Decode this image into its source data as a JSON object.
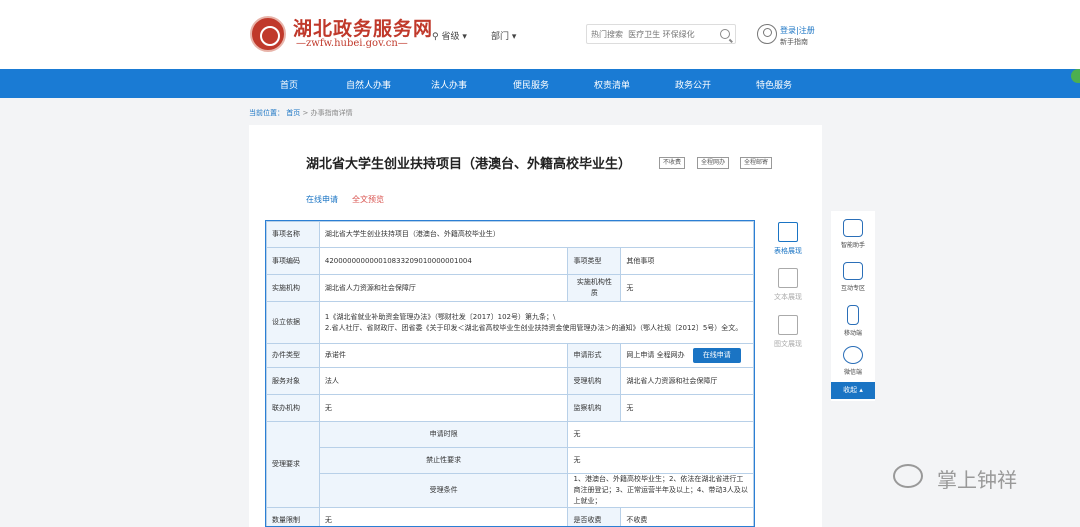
{
  "header": {
    "site_title": "湖北政务服务网",
    "site_url": "—zwfw.hubei.gov.cn—",
    "region_label": "省级",
    "dept_label": "部门",
    "search_placeholder": "热门搜索  医疗卫生 环保绿化",
    "login_label": "登录|注册",
    "guide_label": "新手指南"
  },
  "nav": {
    "items": [
      "首页",
      "自然人办事",
      "法人办事",
      "便民服务",
      "权责清单",
      "政务公开",
      "特色服务"
    ]
  },
  "breadcrumb": {
    "label": "当前位置：",
    "home": "首页",
    "sep": ">",
    "current": "办事指南详情"
  },
  "page": {
    "title": "湖北省大学生创业扶持项目（港澳台、外籍高校毕业生）",
    "tags": [
      "不收费",
      "全程网办",
      "全程邮寄"
    ],
    "link_apply": "在线申请",
    "link_preview": "全文预览"
  },
  "table": {
    "item_name_label": "事项名称",
    "item_name": "湖北省大学生创业扶持项目（港澳台、外籍高校毕业生）",
    "code_label": "事项编码",
    "code": "420000000000010833209010000001004",
    "type_label": "事项类型",
    "type": "其他事项",
    "org_label": "实施机构",
    "org": "湖北省人力资源和社会保障厅",
    "org_nature_label": "实施机构性质",
    "org_nature": "无",
    "basis_label": "设立依据",
    "basis_line1": "1《湖北省就业补助资金管理办法》（鄂财社发〔2017〕102号）第九条；\\",
    "basis_line2": "2.省人社厅、省财政厅、团省委《关于印发＜湖北省高校毕业生创业扶持资金使用管理办法＞的通知》（鄂人社规〔2012〕5号）全文。",
    "handle_type_label": "办件类型",
    "handle_type": "承诺件",
    "apply_form_label": "申请形式",
    "apply_form": "网上申请  全程网办",
    "apply_button": "在线申请",
    "target_label": "服务对象",
    "target": "法人",
    "accept_org_label": "受理机构",
    "accept_org": "湖北省人力资源和社会保障厅",
    "co_org_label": "联办机构",
    "co_org": "无",
    "supervise_label": "监察机构",
    "supervise": "无",
    "req_label": "受理要求",
    "req_time_label": "申请时限",
    "req_time": "无",
    "req_forbid_label": "禁止性要求",
    "req_forbid": "无",
    "req_cond_label": "受理条件",
    "req_cond": "1、港澳台、外籍高校毕业生；2、依法在湖北省进行工商注册登记；3、正常运营半年及以上；4、带动3人及以上就业；",
    "quantity_label": "数量限制",
    "quantity": "无",
    "fee_label": "是否收费",
    "fee": "不收费"
  },
  "view_modes": [
    {
      "label": "表格展现",
      "icon": "table-view-icon"
    },
    {
      "label": "文本展现",
      "icon": "text-view-icon"
    },
    {
      "label": "图文展现",
      "icon": "image-text-view-icon"
    }
  ],
  "helper": {
    "items": [
      {
        "label": "智能助手",
        "icon": "robot-icon"
      },
      {
        "label": "互动专区",
        "icon": "chat-icon"
      },
      {
        "label": "移动端",
        "icon": "mobile-icon"
      },
      {
        "label": "微信端",
        "icon": "wechat-icon"
      }
    ],
    "collapse": "收起 ▴"
  },
  "watermark": "掌上钟祥",
  "colors": {
    "brand_red": "#c0392b",
    "nav_blue": "#1a7bd4",
    "link_blue": "#1a74c4",
    "alert_red": "#d9534f"
  }
}
